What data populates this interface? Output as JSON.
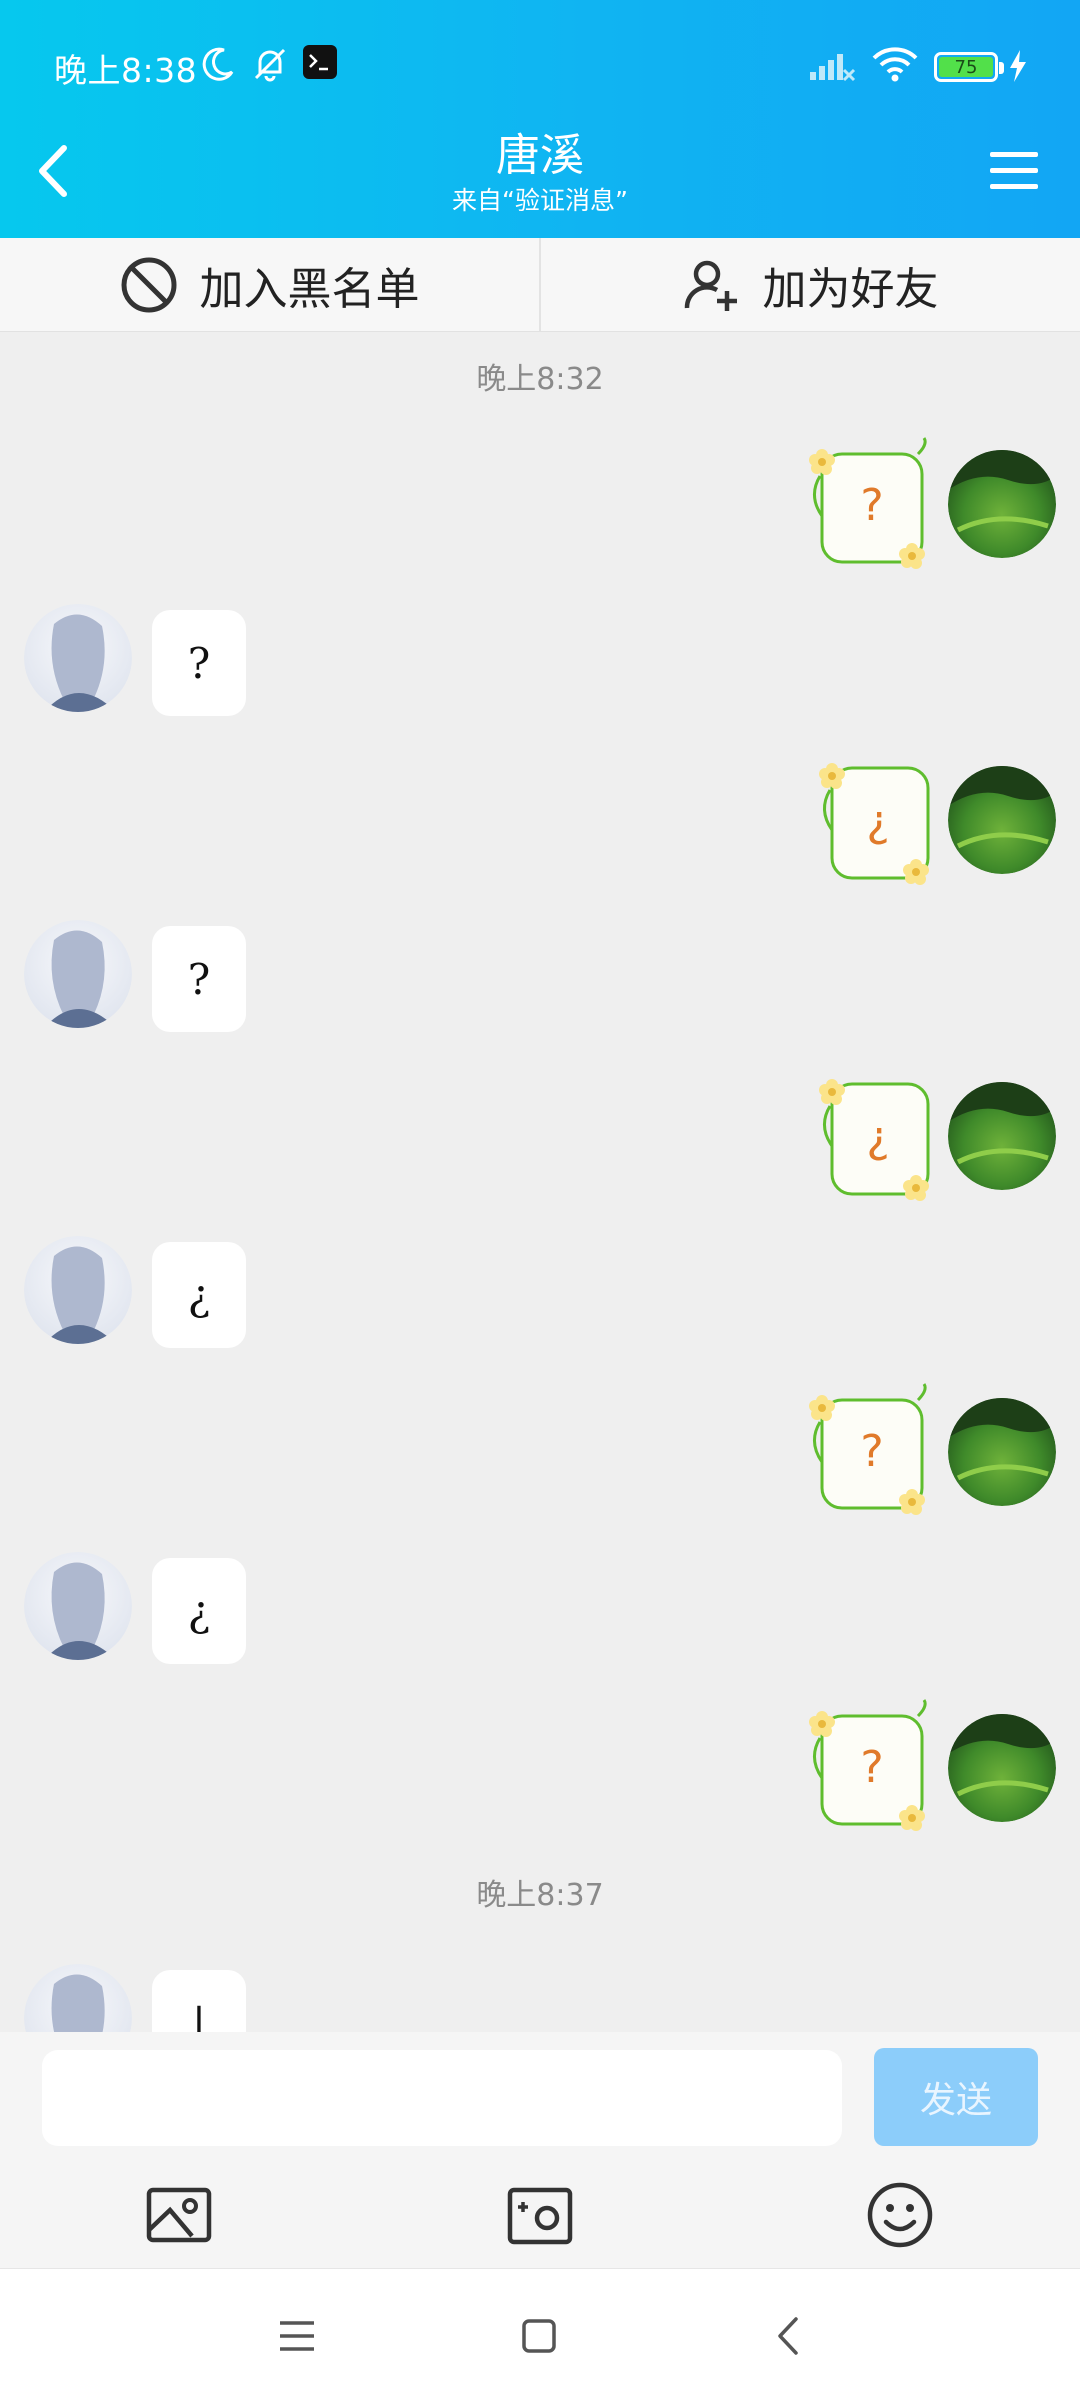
{
  "status_bar": {
    "time": "晚上8:38",
    "battery": "75",
    "icons": [
      "moon-icon",
      "bell-off-icon",
      "terminal-icon",
      "signal-icon",
      "wifi-icon",
      "battery-icon",
      "charging-icon"
    ]
  },
  "header": {
    "title": "唐溪",
    "subtitle": "来自“验证消息”",
    "back_icon": "chevron-left-icon",
    "menu_icon": "menu-icon"
  },
  "actions": {
    "blacklist_label": "加入黑名单",
    "add_friend_label": "加为好友"
  },
  "chat": {
    "timestamps": [
      "晚上8:32",
      "晚上8:37"
    ],
    "messages": [
      {
        "sender": "me",
        "type": "sticker",
        "text": "?"
      },
      {
        "sender": "other",
        "type": "text",
        "text": "?"
      },
      {
        "sender": "me",
        "type": "sticker",
        "text": "¿"
      },
      {
        "sender": "other",
        "type": "text",
        "text": "?"
      },
      {
        "sender": "me",
        "type": "sticker",
        "text": "¿"
      },
      {
        "sender": "other",
        "type": "text",
        "text": "¿"
      },
      {
        "sender": "me",
        "type": "sticker",
        "text": "?"
      },
      {
        "sender": "other",
        "type": "text",
        "text": "¿"
      },
      {
        "sender": "me",
        "type": "sticker",
        "text": "?"
      },
      {
        "sender": "other",
        "type": "text",
        "text": "|"
      }
    ]
  },
  "input": {
    "value": "",
    "placeholder": "",
    "send_label": "发送"
  },
  "toolbar": {
    "icons": [
      "image-icon",
      "camera-icon",
      "emoji-icon"
    ]
  },
  "nav": {
    "icons": [
      "recents-icon",
      "home-icon",
      "back-icon"
    ]
  },
  "colors": {
    "header_start": "#06c8ee",
    "header_end": "#12a6f4",
    "send_button": "#8ccdfa",
    "chat_background": "#efefef",
    "sticker_border": "#5fbd2e",
    "sticker_text": "#e07a2a"
  }
}
